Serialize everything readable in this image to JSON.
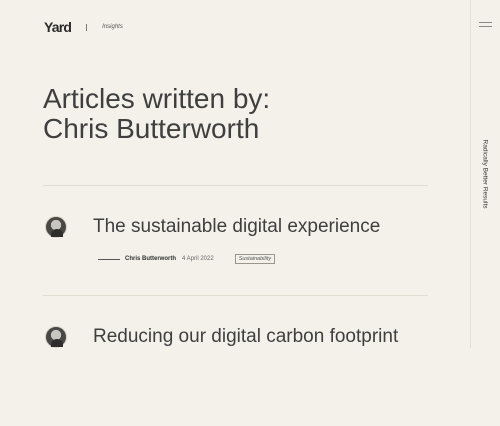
{
  "header": {
    "logo": "Yard",
    "section": "Insights"
  },
  "sidebar": {
    "tagline": "Radically Better Results"
  },
  "page": {
    "title_line1": "Articles written by:",
    "title_line2": "Chris Butterworth"
  },
  "articles": [
    {
      "title": "The sustainable digital experience",
      "author": "Chris Butterworth",
      "date": "4 April 2022",
      "tag": "Sustainability"
    },
    {
      "title": "Reducing our digital carbon footprint"
    }
  ]
}
